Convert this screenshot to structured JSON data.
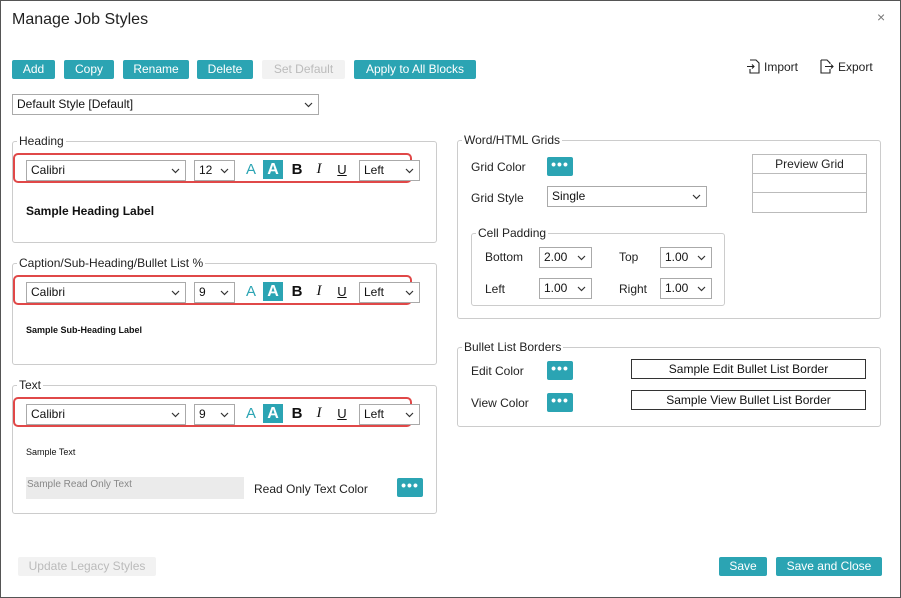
{
  "dialog": {
    "title": "Manage Job Styles",
    "close": "×"
  },
  "toolbar": {
    "add": "Add",
    "copy": "Copy",
    "rename": "Rename",
    "delete": "Delete",
    "set_default": "Set Default",
    "apply_all": "Apply to All Blocks",
    "import": "Import",
    "export": "Export"
  },
  "style_select": {
    "value": "Default Style [Default]"
  },
  "heading": {
    "title": "Heading",
    "font": "Calibri",
    "size": "12",
    "align": "Left",
    "sample": "Sample Heading Label"
  },
  "caption": {
    "title": "Caption/Sub-Heading/Bullet List %",
    "font": "Calibri",
    "size": "9",
    "align": "Left",
    "sample": "Sample Sub-Heading Label"
  },
  "text": {
    "title": "Text",
    "font": "Calibri",
    "size": "9",
    "align": "Left",
    "sample": "Sample Text",
    "readonly_sample": "Sample Read Only Text",
    "readonly_color_label": "Read Only Text Color"
  },
  "font_buttons": {
    "color": "A",
    "highlight": "A",
    "bold": "B",
    "italic": "I",
    "underline": "U"
  },
  "grids": {
    "title": "Word/HTML Grids",
    "grid_color_label": "Grid Color",
    "grid_style_label": "Grid Style",
    "grid_style": "Single",
    "preview_header": "Preview Grid",
    "cell_padding": {
      "title": "Cell Padding",
      "bottom_label": "Bottom",
      "bottom": "2.00",
      "top_label": "Top",
      "top": "1.00",
      "left_label": "Left",
      "left": "1.00",
      "right_label": "Right",
      "right": "1.00"
    }
  },
  "bullet_borders": {
    "title": "Bullet List Borders",
    "edit_label": "Edit Color",
    "edit_sample": "Sample Edit Bullet List Border",
    "view_label": "View Color",
    "view_sample": "Sample View Bullet List Border"
  },
  "footer": {
    "update_legacy": "Update Legacy Styles",
    "save": "Save",
    "save_close": "Save and Close"
  },
  "dots_glyph": "•••",
  "colors": {
    "accent": "#2ba4b3",
    "highlight_border": "#e04848"
  }
}
